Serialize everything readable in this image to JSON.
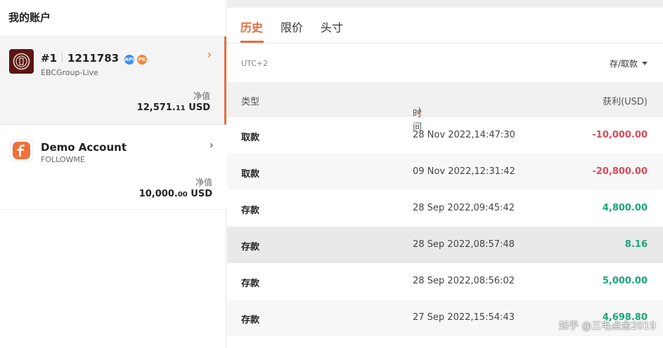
{
  "left": {
    "title": "我的账户",
    "accounts": [
      {
        "number": "#1",
        "id": "1211783",
        "badge_api": "API",
        "badge_pk": "PK",
        "broker": "EBCGroup-Live",
        "net_label": "净值",
        "net_int": "12,571.",
        "net_dec": "11",
        "currency": "USD",
        "chevron": "›",
        "selected": true
      },
      {
        "name": "Demo Account",
        "broker": "FOLLOWME",
        "net_label": "净值",
        "net_int": "10,000.",
        "net_dec": "00",
        "currency": "USD",
        "chevron": "›",
        "selected": false
      }
    ]
  },
  "right": {
    "tabs": [
      "历史",
      "限价",
      "头寸"
    ],
    "active_tab": 0,
    "timezone": "UTC+2",
    "filter_label": "存/取款",
    "columns": {
      "type": "类型",
      "time": "时间",
      "pnl": "获利(USD)",
      "sort_arrow": "↓"
    },
    "rows": [
      {
        "type": "取款",
        "time": "28 Nov 2022,14:47:30",
        "pnl": "-10,000.00",
        "sign": "neg"
      },
      {
        "type": "取款",
        "time": "09 Nov 2022,12:31:42",
        "pnl": "-20,800.00",
        "sign": "neg"
      },
      {
        "type": "存款",
        "time": "28 Sep 2022,09:45:42",
        "pnl": "4,800.00",
        "sign": "pos"
      },
      {
        "type": "存款",
        "time": "28 Sep 2022,08:57:48",
        "pnl": "8.16",
        "sign": "pos"
      },
      {
        "type": "存款",
        "time": "28 Sep 2022,08:56:02",
        "pnl": "5,000.00",
        "sign": "pos"
      },
      {
        "type": "存款",
        "time": "27 Sep 2022,15:54:43",
        "pnl": "4,698.80",
        "sign": "pos"
      }
    ]
  },
  "watermark": "知乎 @三毛点金2019",
  "colors": {
    "accent": "#e86b3a",
    "negative": "#d94b57",
    "positive": "#1aa57b"
  }
}
